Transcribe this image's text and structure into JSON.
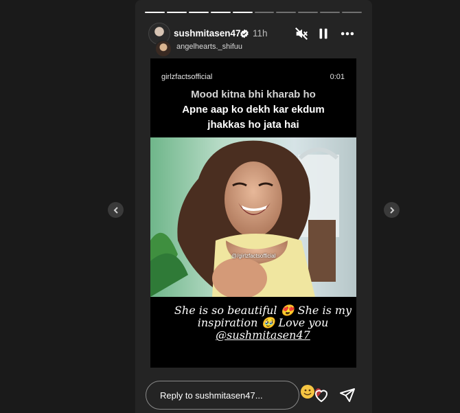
{
  "story": {
    "progress_total": 10,
    "progress_completed": 5,
    "user": {
      "username": "sushmitasen47",
      "time_ago": "11h",
      "verified": true
    },
    "shared_from": "angelhearts._shifuu",
    "controls": [
      "mute-icon",
      "pause-icon",
      "more-icon"
    ]
  },
  "video": {
    "handle": "girlzfactsofficial",
    "time": "0:01",
    "caption": [
      "Mood kitna bhi kharab ho",
      "Apne aap ko dekh kar ekdum",
      "jhakkas ho jata hai"
    ],
    "watermark": "@/girlzfactsofficial"
  },
  "comment": {
    "line1": "She is so beautiful 😍 She is my",
    "line2": "inspiration 🥹 Love you",
    "mention": "@sushmitasen47"
  },
  "reply": {
    "placeholder": "Reply to sushmitasen47..."
  },
  "colors": {
    "background": "#1a1a1a",
    "panel": "#242424",
    "text": "#ffffff"
  }
}
